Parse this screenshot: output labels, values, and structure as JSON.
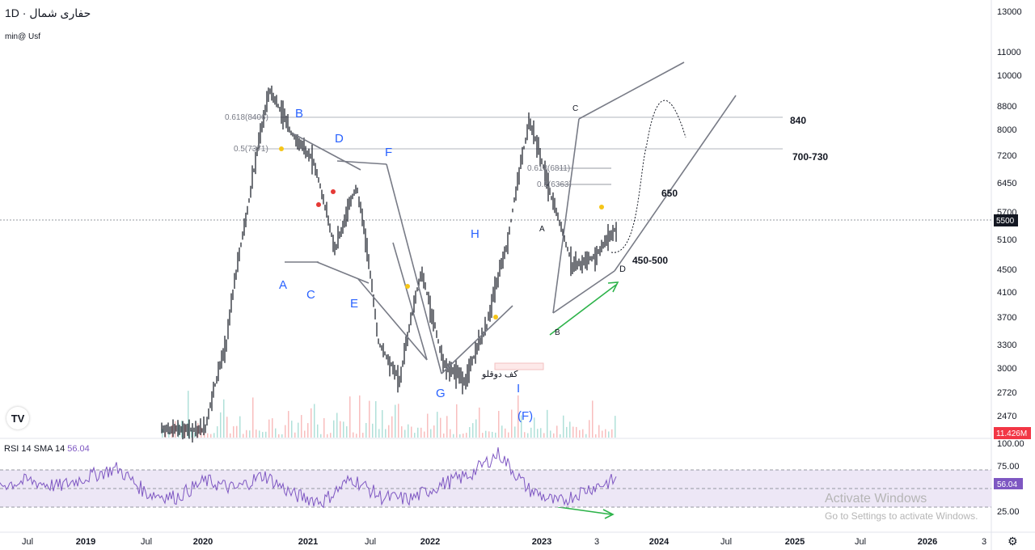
{
  "symbol": "حفاری شمال · 1D",
  "author": "min@ Usf",
  "price_axis": {
    "ticks": [
      "13000",
      "11000",
      "10000",
      "8800",
      "8000",
      "7200",
      "6450",
      "5700",
      "5100",
      "4500",
      "4100",
      "3700",
      "3300",
      "3000",
      "2720",
      "2470"
    ],
    "current_price": "5500",
    "volume_label": "11.426M"
  },
  "rsi": {
    "legend_name": "RSI 14 SMA 14",
    "legend_value": "56.04",
    "ticks": [
      "100.00",
      "75.00",
      "25.00"
    ],
    "current": "56.04"
  },
  "time_axis": [
    "Jul",
    "2019",
    "Jul",
    "2020",
    "2021",
    "Jul",
    "2022",
    "2023",
    "3",
    "2024",
    "Jul",
    "2025",
    "Jul",
    "2026",
    "3"
  ],
  "annotations": {
    "fib_large_618": "0.618(8406)",
    "fib_large_05": "0.5(7371)",
    "fib_small_618": "0.618(6811)",
    "fib_small_05": "0.5(6363)",
    "level_840": "840",
    "level_700_730": "700-730",
    "level_650": "650",
    "level_450_500": "450-500",
    "double_bottom": "کف دوقلو",
    "waves": {
      "B": "B",
      "D": "D",
      "F": "F",
      "H": "H",
      "A": "A",
      "C": "C",
      "E": "E",
      "G": "G",
      "I": "I",
      "F_paren": "(F)"
    },
    "small_waves": {
      "a": "A",
      "b": "B",
      "c": "C",
      "d": "D"
    }
  },
  "watermark": {
    "title": "Activate Windows",
    "subtitle": "Go to Settings to activate Windows."
  },
  "colors": {
    "accent_purple": "#7e57c2",
    "rsi_band": "#ede7f6",
    "volume_red": "#f5a3a3",
    "volume_green": "#8fd3c9",
    "label_blue": "#2962ff",
    "arrow_green": "#2db34a",
    "volume_badge": "#f23645"
  },
  "chart_data": [
    {
      "type": "line",
      "title": "",
      "x": [
        "2019-01",
        "2019-07",
        "2020-01",
        "2020-04",
        "2020-07",
        "2020-09",
        "2020-11",
        "2021-01",
        "2021-04",
        "2021-07",
        "2021-10",
        "2022-01",
        "2022-04",
        "2022-07",
        "2022-10",
        "2022-12",
        "2023-02",
        "2023-04",
        "2023-06",
        "2023-08",
        "2023-10",
        "2023-12"
      ],
      "series": [
        {
          "values": [
            2470,
            2470,
            2470,
            3500,
            6000,
            9500,
            8000,
            7200,
            5000,
            6500,
            3500,
            3000,
            4600,
            3200,
            3000,
            3700,
            5200,
            8400,
            6200,
            4700,
            4900,
            5500
          ]
        }
      ],
      "y_scale": "log",
      "ylim": [
        2400,
        13000
      ],
      "horizontal_levels": [
        8406,
        7371,
        6811,
        6363,
        5500
      ]
    },
    {
      "type": "line",
      "title": "RSI 14 SMA 14",
      "series": [
        {
          "name": "RSI",
          "values": [
            50,
            55,
            48,
            60,
            70,
            40,
            35,
            55,
            45,
            62,
            38,
            30,
            58,
            35,
            33,
            50,
            62,
            88,
            45,
            28,
            45,
            56.04
          ]
        }
      ],
      "ylim": [
        0,
        100
      ],
      "bands": [
        30,
        70
      ]
    }
  ]
}
